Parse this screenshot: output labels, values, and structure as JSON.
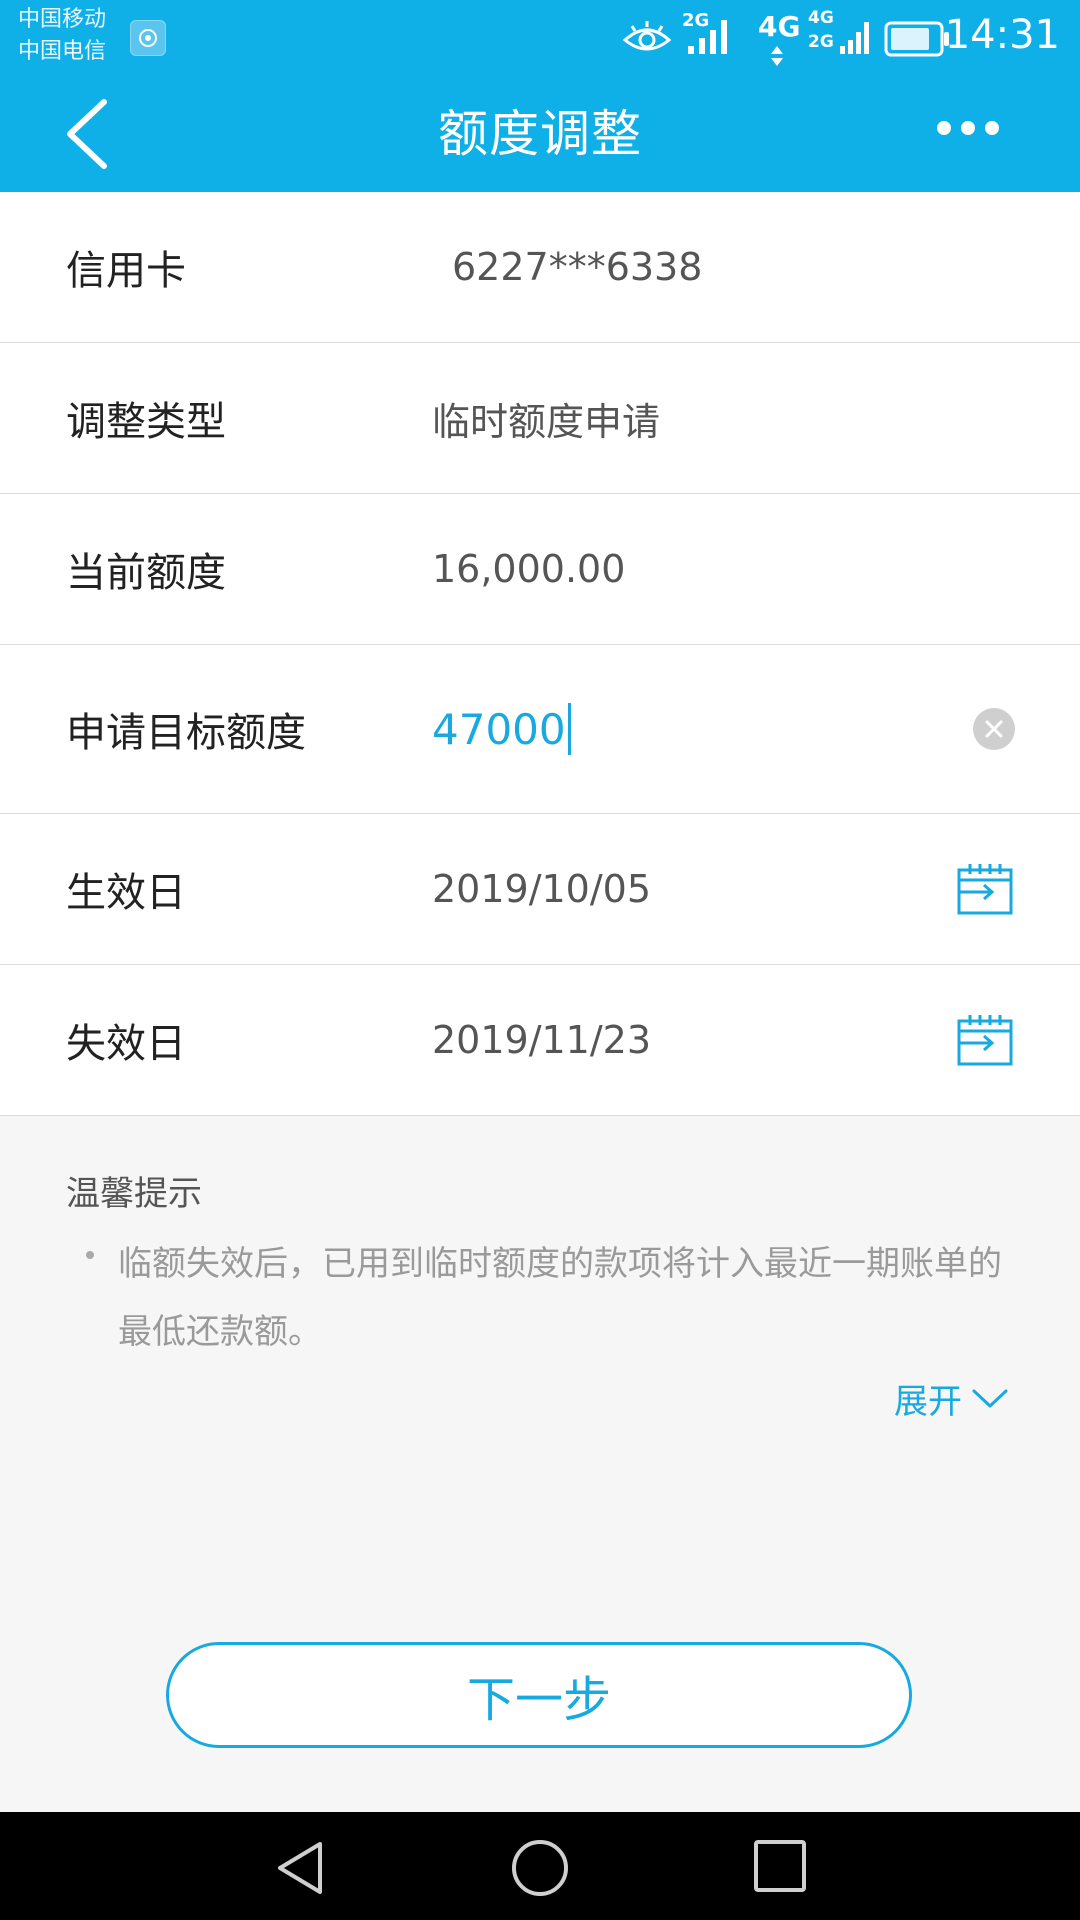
{
  "status_bar": {
    "carrier_1": "中国移动",
    "carrier_2": "中国电信",
    "net_2g": "2G",
    "net_4g": "4G",
    "net_4g_small": "4G",
    "net_2g_small": "2G",
    "time": "14:31",
    "icons": [
      "eye-icon",
      "signal-icon",
      "battery-icon"
    ]
  },
  "header": {
    "title": "额度调整",
    "back_icon": "chevron-left-icon",
    "more_icon": "more-dots-icon"
  },
  "form": {
    "card": {
      "label": "信用卡",
      "value": "6227***6338"
    },
    "adjust_type": {
      "label": "调整类型",
      "value": "临时额度申请"
    },
    "current_limit": {
      "label": "当前额度",
      "value": "16,000.00"
    },
    "target_limit": {
      "label": "申请目标额度",
      "value": "47000"
    },
    "effective_date": {
      "label": "生效日",
      "value": "2019/10/05"
    },
    "expiry_date": {
      "label": "失效日",
      "value": "2019/11/23"
    }
  },
  "tips": {
    "title": "温馨提示",
    "items": [
      "临额失效后，已用到临时额度的款项将计入最近一期账单的最低还款额。"
    ],
    "expand_label": "展开"
  },
  "actions": {
    "next_label": "下一步"
  },
  "colors": {
    "brand": "#0fb0e8",
    "accent_text": "#17a9df",
    "background": "#f6f6f6"
  }
}
